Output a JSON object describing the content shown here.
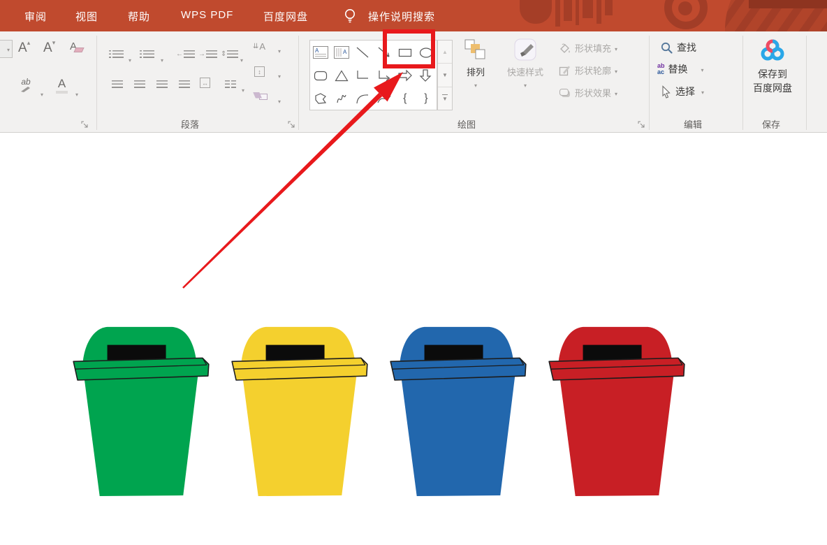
{
  "titlebar": {
    "menu_items": [
      "审阅",
      "视图",
      "帮助",
      "WPS PDF",
      "百度网盘"
    ],
    "search_label": "操作说明搜索",
    "bg_color": "#c04a2e",
    "decoration_color": "#a23d27"
  },
  "ribbon": {
    "paragraph": {
      "label": "段落"
    },
    "drawing": {
      "label": "绘图",
      "arrange_label": "排列",
      "quick_styles_label": "快速样式",
      "shape_fill_label": "形状填充",
      "shape_outline_label": "形状轮廓",
      "shape_effects_label": "形状效果"
    },
    "edit": {
      "label": "编辑",
      "find_label": "查找",
      "replace_label": "替换",
      "select_label": "选择",
      "replace_icon_top": "ab",
      "replace_icon_bottom": "ac"
    },
    "save": {
      "label": "保存",
      "button_line1": "保存到",
      "button_line2": "百度网盘"
    }
  },
  "icons": {
    "lightbulb": "bulb-outline",
    "search": "magnifier",
    "select": "cursor-arrow",
    "save_to_netdisk": "baidu-cloud-trefoil",
    "letter_a": "A",
    "grow_caret": "▴",
    "shrink_caret": "▾",
    "highlight_letters": "ab",
    "brace_left": "{",
    "brace_right": "}"
  },
  "annotation": {
    "arrow_color": "#e8191c",
    "highlight_box_color": "#e8191c",
    "target": "rectangle-shape-tool"
  },
  "bins": [
    {
      "name": "green-bin",
      "color": "#00a44f"
    },
    {
      "name": "yellow-bin",
      "color": "#f4d02e"
    },
    {
      "name": "blue-bin",
      "color": "#2267ad"
    },
    {
      "name": "red-bin",
      "color": "#c81f25"
    }
  ],
  "bin_detail": {
    "slot_color": "#0b0b0b",
    "outline_color": "#1c1c1c"
  }
}
